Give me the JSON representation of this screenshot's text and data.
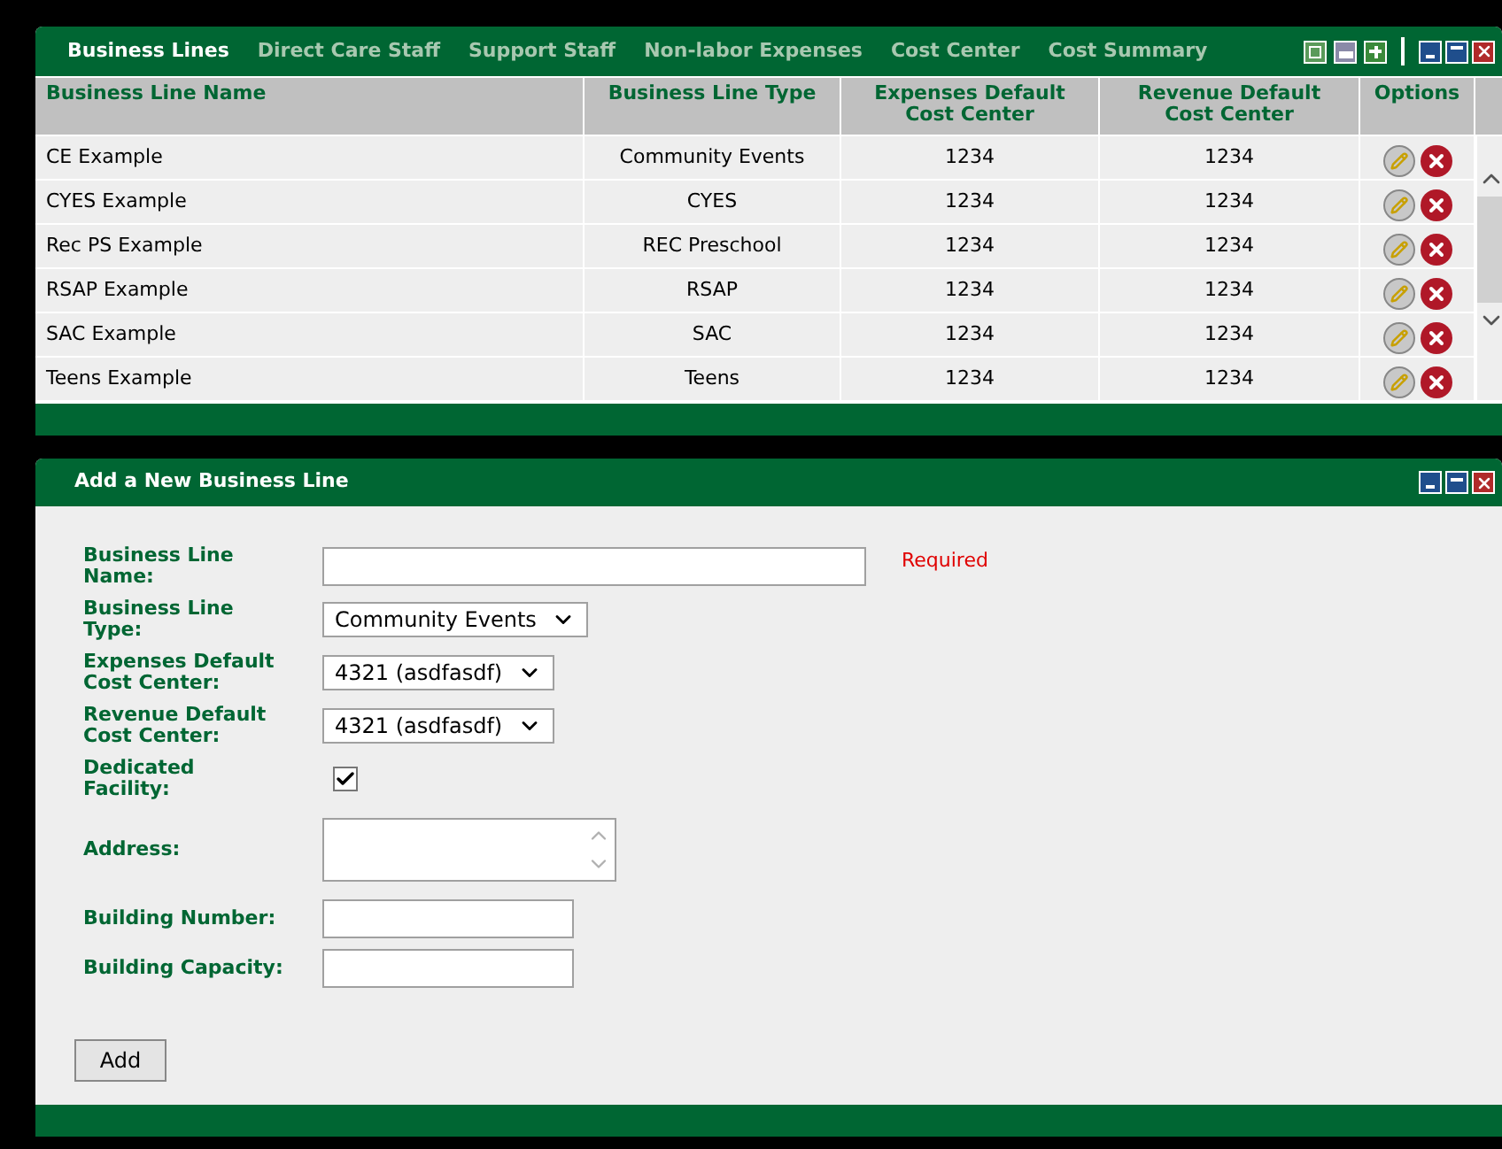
{
  "tabs": [
    {
      "label": "Business Lines",
      "selected": true
    },
    {
      "label": "Direct Care Staff",
      "selected": false
    },
    {
      "label": "Support Staff",
      "selected": false
    },
    {
      "label": "Non-labor Expenses",
      "selected": false
    },
    {
      "label": "Cost Center",
      "selected": false
    },
    {
      "label": "Cost Summary",
      "selected": false
    }
  ],
  "table": {
    "columns": [
      "Business Line Name",
      "Business Line Type",
      "Expenses Default Cost Center",
      "Revenue Default Cost Center",
      "Options"
    ],
    "rows": [
      {
        "name": "CE Example",
        "type": "Community Events",
        "expenses": "1234",
        "revenue": "1234"
      },
      {
        "name": "CYES Example",
        "type": "CYES",
        "expenses": "1234",
        "revenue": "1234"
      },
      {
        "name": "Rec PS Example",
        "type": "REC Preschool",
        "expenses": "1234",
        "revenue": "1234"
      },
      {
        "name": "RSAP Example",
        "type": "RSAP",
        "expenses": "1234",
        "revenue": "1234"
      },
      {
        "name": "SAC Example",
        "type": "SAC",
        "expenses": "1234",
        "revenue": "1234"
      },
      {
        "name": "Teens Example",
        "type": "Teens",
        "expenses": "1234",
        "revenue": "1234"
      }
    ]
  },
  "form": {
    "title": "Add a New Business Line",
    "fields": [
      {
        "kind": "wide-text",
        "label": "Business Line Name:",
        "note": "Required"
      },
      {
        "kind": "select",
        "label": "Business Line Type:",
        "value": "Community Events"
      },
      {
        "kind": "select",
        "label": "Expenses Default Cost Center:",
        "value": "4321 (asdfasdf)"
      },
      {
        "kind": "select",
        "label": "Revenue Default Cost Center:",
        "value": "4321 (asdfasdf)"
      },
      {
        "kind": "checkbox",
        "label": "Dedicated Facility:",
        "checked": true
      },
      {
        "kind": "textarea",
        "label": "Address:"
      },
      {
        "kind": "text",
        "label": "Building Number:"
      },
      {
        "kind": "text",
        "label": "Building Capacity:"
      }
    ],
    "submit": "Add"
  }
}
